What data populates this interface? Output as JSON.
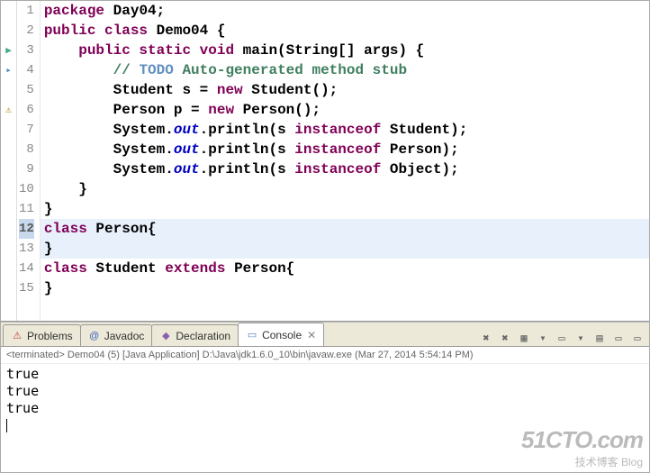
{
  "code": {
    "lines": [
      {
        "n": 1,
        "mark": "",
        "tokens": [
          [
            "kw",
            "package"
          ],
          [
            "norm",
            " Day04;"
          ]
        ]
      },
      {
        "n": 2,
        "mark": "",
        "tokens": [
          [
            "kw",
            "public class"
          ],
          [
            "norm",
            " Demo04 {"
          ]
        ]
      },
      {
        "n": 3,
        "mark": "run",
        "tokens": [
          [
            "norm",
            "    "
          ],
          [
            "kw",
            "public static void"
          ],
          [
            "norm",
            " main(String[] args) {"
          ]
        ]
      },
      {
        "n": 4,
        "mark": "tag",
        "tokens": [
          [
            "norm",
            "        "
          ],
          [
            "com",
            "// "
          ],
          [
            "todo",
            "TODO"
          ],
          [
            "com",
            " Auto-generated method stub"
          ]
        ]
      },
      {
        "n": 5,
        "mark": "",
        "tokens": [
          [
            "norm",
            "        Student s = "
          ],
          [
            "kw",
            "new"
          ],
          [
            "norm",
            " Student();"
          ]
        ]
      },
      {
        "n": 6,
        "mark": "warn",
        "tokens": [
          [
            "norm",
            "        Person p = "
          ],
          [
            "kw",
            "new"
          ],
          [
            "norm",
            " Person();"
          ]
        ]
      },
      {
        "n": 7,
        "mark": "",
        "tokens": [
          [
            "norm",
            "        System."
          ],
          [
            "field",
            "out"
          ],
          [
            "norm",
            ".println(s "
          ],
          [
            "kw",
            "instanceof"
          ],
          [
            "norm",
            " Student);"
          ]
        ]
      },
      {
        "n": 8,
        "mark": "",
        "tokens": [
          [
            "norm",
            "        System."
          ],
          [
            "field",
            "out"
          ],
          [
            "norm",
            ".println(s "
          ],
          [
            "kw",
            "instanceof"
          ],
          [
            "norm",
            " Person);"
          ]
        ]
      },
      {
        "n": 9,
        "mark": "",
        "tokens": [
          [
            "norm",
            "        System."
          ],
          [
            "field",
            "out"
          ],
          [
            "norm",
            ".println(s "
          ],
          [
            "kw",
            "instanceof"
          ],
          [
            "norm",
            " Object);"
          ]
        ]
      },
      {
        "n": 10,
        "mark": "",
        "tokens": [
          [
            "norm",
            "    }"
          ]
        ]
      },
      {
        "n": 11,
        "mark": "",
        "tokens": [
          [
            "norm",
            "}"
          ]
        ]
      },
      {
        "n": 12,
        "mark": "",
        "hl": true,
        "active": true,
        "tokens": [
          [
            "kw",
            "class"
          ],
          [
            "norm",
            " Person{"
          ]
        ]
      },
      {
        "n": 13,
        "mark": "",
        "hl": true,
        "tokens": [
          [
            "norm",
            "}"
          ]
        ]
      },
      {
        "n": 14,
        "mark": "",
        "tokens": [
          [
            "kw",
            "class"
          ],
          [
            "norm",
            " Student "
          ],
          [
            "kw",
            "extends"
          ],
          [
            "norm",
            " Person{"
          ]
        ]
      },
      {
        "n": 15,
        "mark": "",
        "tokens": [
          [
            "norm",
            "}"
          ]
        ]
      }
    ]
  },
  "tabs": [
    {
      "id": "problems",
      "label": "Problems",
      "icon": "⚠",
      "iconColor": "#c04040"
    },
    {
      "id": "javadoc",
      "label": "Javadoc",
      "icon": "@",
      "iconColor": "#4060c0"
    },
    {
      "id": "declaration",
      "label": "Declaration",
      "icon": "◆",
      "iconColor": "#8860b0"
    },
    {
      "id": "console",
      "label": "Console",
      "icon": "▭",
      "iconColor": "#5080c0",
      "active": true,
      "closeable": true
    }
  ],
  "toolbar_icons": [
    "✖",
    "✖",
    "▦",
    "▾",
    "▭",
    "▾",
    "▤",
    "▭",
    "▭"
  ],
  "console": {
    "status": "<terminated> Demo04 (5) [Java Application] D:\\Java\\jdk1.6.0_10\\bin\\javaw.exe (Mar 27, 2014 5:54:14 PM)",
    "output": [
      "true",
      "true",
      "true"
    ]
  },
  "watermark": {
    "big": "51CTO.com",
    "sm": "技术博客    Blog"
  }
}
